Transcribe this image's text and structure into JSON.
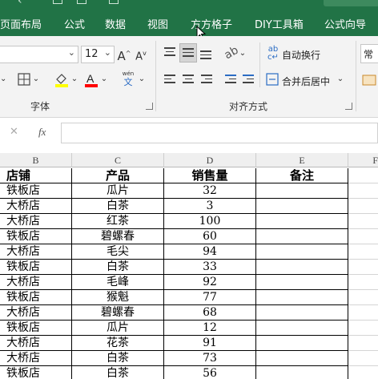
{
  "tabs": [
    "页面布局",
    "公式",
    "数据",
    "视图",
    "方方格子",
    "DIY工具箱",
    "公式向导"
  ],
  "ribbon": {
    "font_size": "12",
    "font_group_label": "字体",
    "align_group_label": "对齐方式",
    "wrap_text_label": "自动换行",
    "merge_center_label": "合并后居中",
    "number_format_partial": "常规",
    "wen_label": "wén",
    "wen_char": "文"
  },
  "formula_bar": {
    "cancel_glyph": "✕",
    "confirm_glyph": "✓",
    "fx_label": "fx",
    "value": ""
  },
  "column_headers": [
    "B",
    "C",
    "D",
    "E",
    "F"
  ],
  "table": {
    "headers": [
      "店铺",
      "产品",
      "销售量",
      "备注"
    ],
    "rows": [
      [
        "铁板店",
        "瓜片",
        "32",
        ""
      ],
      [
        "大桥店",
        "白茶",
        "3",
        ""
      ],
      [
        "大桥店",
        "红茶",
        "100",
        ""
      ],
      [
        "铁板店",
        "碧螺春",
        "60",
        ""
      ],
      [
        "大桥店",
        "毛尖",
        "94",
        ""
      ],
      [
        "铁板店",
        "白茶",
        "33",
        ""
      ],
      [
        "大桥店",
        "毛峰",
        "92",
        ""
      ],
      [
        "铁板店",
        "猴魁",
        "77",
        ""
      ],
      [
        "大桥店",
        "碧螺春",
        "68",
        ""
      ],
      [
        "铁板店",
        "瓜片",
        "12",
        ""
      ],
      [
        "大桥店",
        "花茶",
        "91",
        ""
      ],
      [
        "大桥店",
        "白茶",
        "73",
        ""
      ],
      [
        "铁板店",
        "白茶",
        "56",
        ""
      ]
    ]
  },
  "colors": {
    "ribbon_green": "#217346",
    "highlight_yellow": "#ffff00",
    "font_red": "#ff0000"
  }
}
